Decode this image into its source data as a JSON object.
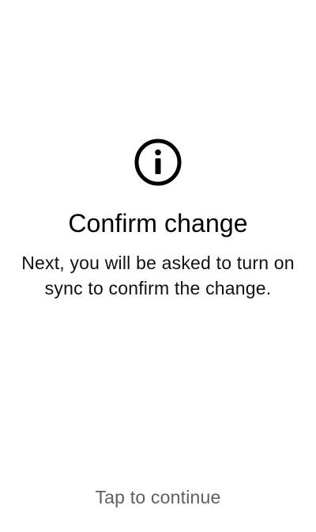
{
  "dialog": {
    "icon": "info-icon",
    "title": "Confirm change",
    "message": "Next, you will be asked to turn on sync to confirm the change.",
    "footer": "Tap to continue"
  },
  "colors": {
    "background": "#ffffff",
    "title": "#000000",
    "message": "#111111",
    "footer": "#5f5f5f"
  }
}
